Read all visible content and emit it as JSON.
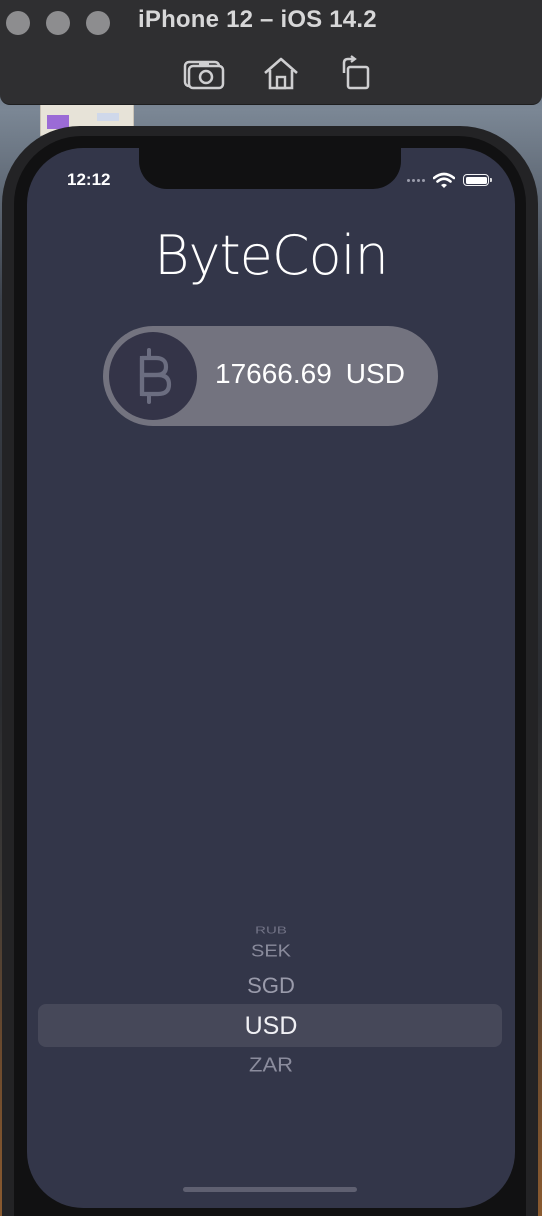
{
  "simulator": {
    "title": "iPhone 12 – iOS 14.2",
    "toolbar": {
      "screenshot_icon": "camera-icon",
      "home_icon": "home-icon",
      "rotate_icon": "rotate-icon"
    }
  },
  "status_bar": {
    "time": "12:12",
    "icons": [
      "cellular-dots-icon",
      "wifi-icon",
      "battery-icon"
    ]
  },
  "app": {
    "title": "ByteCoin",
    "coin_icon": "bitcoin-icon",
    "price_value": "17666.69",
    "currency": "USD"
  },
  "picker": {
    "items": [
      "",
      "RUB",
      "SEK",
      "SGD",
      "USD",
      "ZAR"
    ],
    "selected": "USD"
  },
  "colors": {
    "screen_background": "#333649",
    "pill_background": "#73737f",
    "coin_circle": "#343448",
    "text": "#ffffff"
  }
}
